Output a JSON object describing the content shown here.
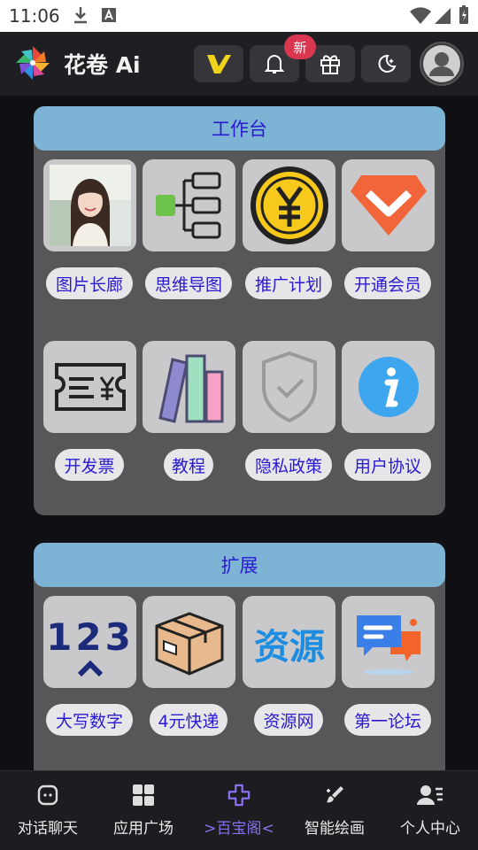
{
  "status_bar": {
    "time": "11:06"
  },
  "header": {
    "title": "花卷 Ai",
    "badge": "新"
  },
  "workbench": {
    "title": "工作台",
    "items": [
      {
        "label": "图片长廊",
        "icon": "portrait-photo-icon"
      },
      {
        "label": "思维导图",
        "icon": "mindmap-icon"
      },
      {
        "label": "推广计划",
        "icon": "yuan-coin-icon"
      },
      {
        "label": "开通会员",
        "icon": "vip-heart-icon"
      },
      {
        "label": "开发票",
        "icon": "invoice-ticket-icon"
      },
      {
        "label": "教程",
        "icon": "books-icon"
      },
      {
        "label": "隐私政策",
        "icon": "shield-check-icon"
      },
      {
        "label": "用户协议",
        "icon": "info-icon"
      }
    ]
  },
  "extension": {
    "title": "扩展",
    "items": [
      {
        "label": "大写数字",
        "icon": "numbers-123-icon"
      },
      {
        "label": "4元快递",
        "icon": "package-box-icon"
      },
      {
        "label": "资源网",
        "icon": "resource-text-icon",
        "icon_text": "资源"
      },
      {
        "label": "第一论坛",
        "icon": "chat-bubbles-icon"
      }
    ]
  },
  "bottom_nav": [
    {
      "label": "对话聊天",
      "icon": "chat-icon"
    },
    {
      "label": "应用广场",
      "icon": "grid-apps-icon"
    },
    {
      "label": ">百宝阁<",
      "icon": "plus-cross-icon",
      "active": true
    },
    {
      "label": "智能绘画",
      "icon": "paint-brush-icon"
    },
    {
      "label": "个人中心",
      "icon": "user-profile-icon"
    }
  ],
  "colors": {
    "accent": "#2a1ad0",
    "panel_head": "#7db3d4",
    "active_nav": "#8a6ff0"
  }
}
